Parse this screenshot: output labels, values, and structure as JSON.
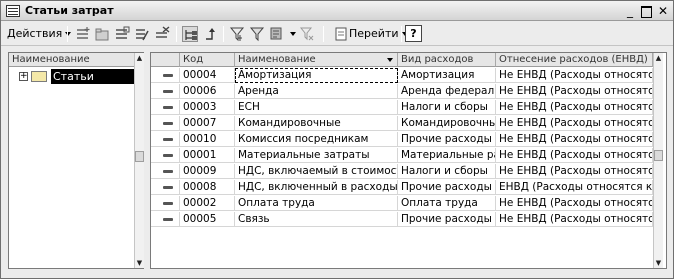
{
  "window": {
    "title": "Статьи затрат"
  },
  "toolbar": {
    "actions_label": "Действия",
    "goto_label": "Перейти",
    "help_label": "?"
  },
  "tree": {
    "header": "Наименование",
    "root": {
      "expander": "+",
      "label": "Статьи затрат"
    }
  },
  "table": {
    "columns": [
      "Код",
      "Наименование",
      "Вид расходов",
      "Отнесение расходов (ЕНВД)"
    ],
    "rows": [
      {
        "code": "00004",
        "name": "Амортизация",
        "type": "Амортизация",
        "attr": "Не ЕНВД (Расходы относятся..."
      },
      {
        "code": "00006",
        "name": "Аренда",
        "type": "Аренда федераль...",
        "attr": "Не ЕНВД (Расходы относятся..."
      },
      {
        "code": "00003",
        "name": "ЕСН",
        "type": "Налоги и сборы",
        "attr": "Не ЕНВД (Расходы относятся..."
      },
      {
        "code": "00007",
        "name": "Командировочные",
        "type": "Командировочны...",
        "attr": "Не ЕНВД (Расходы относятся..."
      },
      {
        "code": "00010",
        "name": "Комиссия посредникам",
        "type": "Прочие расходы",
        "attr": "Не ЕНВД (Расходы относятся..."
      },
      {
        "code": "00001",
        "name": "Материальные затраты",
        "type": "Материальные ра...",
        "attr": "Не ЕНВД (Расходы относятся..."
      },
      {
        "code": "00009",
        "name": "НДС, включаемый в стоимость ...",
        "type": "Налоги и сборы",
        "attr": "Не ЕНВД (Расходы относятся..."
      },
      {
        "code": "00008",
        "name": "НДС, включенный в расходы",
        "type": "Прочие расходы",
        "attr": "ЕНВД (Расходы относятся к д..."
      },
      {
        "code": "00002",
        "name": "Оплата труда",
        "type": "Оплата труда",
        "attr": "Не ЕНВД (Расходы относятся..."
      },
      {
        "code": "00005",
        "name": "Связь",
        "type": "Прочие расходы",
        "attr": "Не ЕНВД (Расходы относятся..."
      }
    ]
  }
}
